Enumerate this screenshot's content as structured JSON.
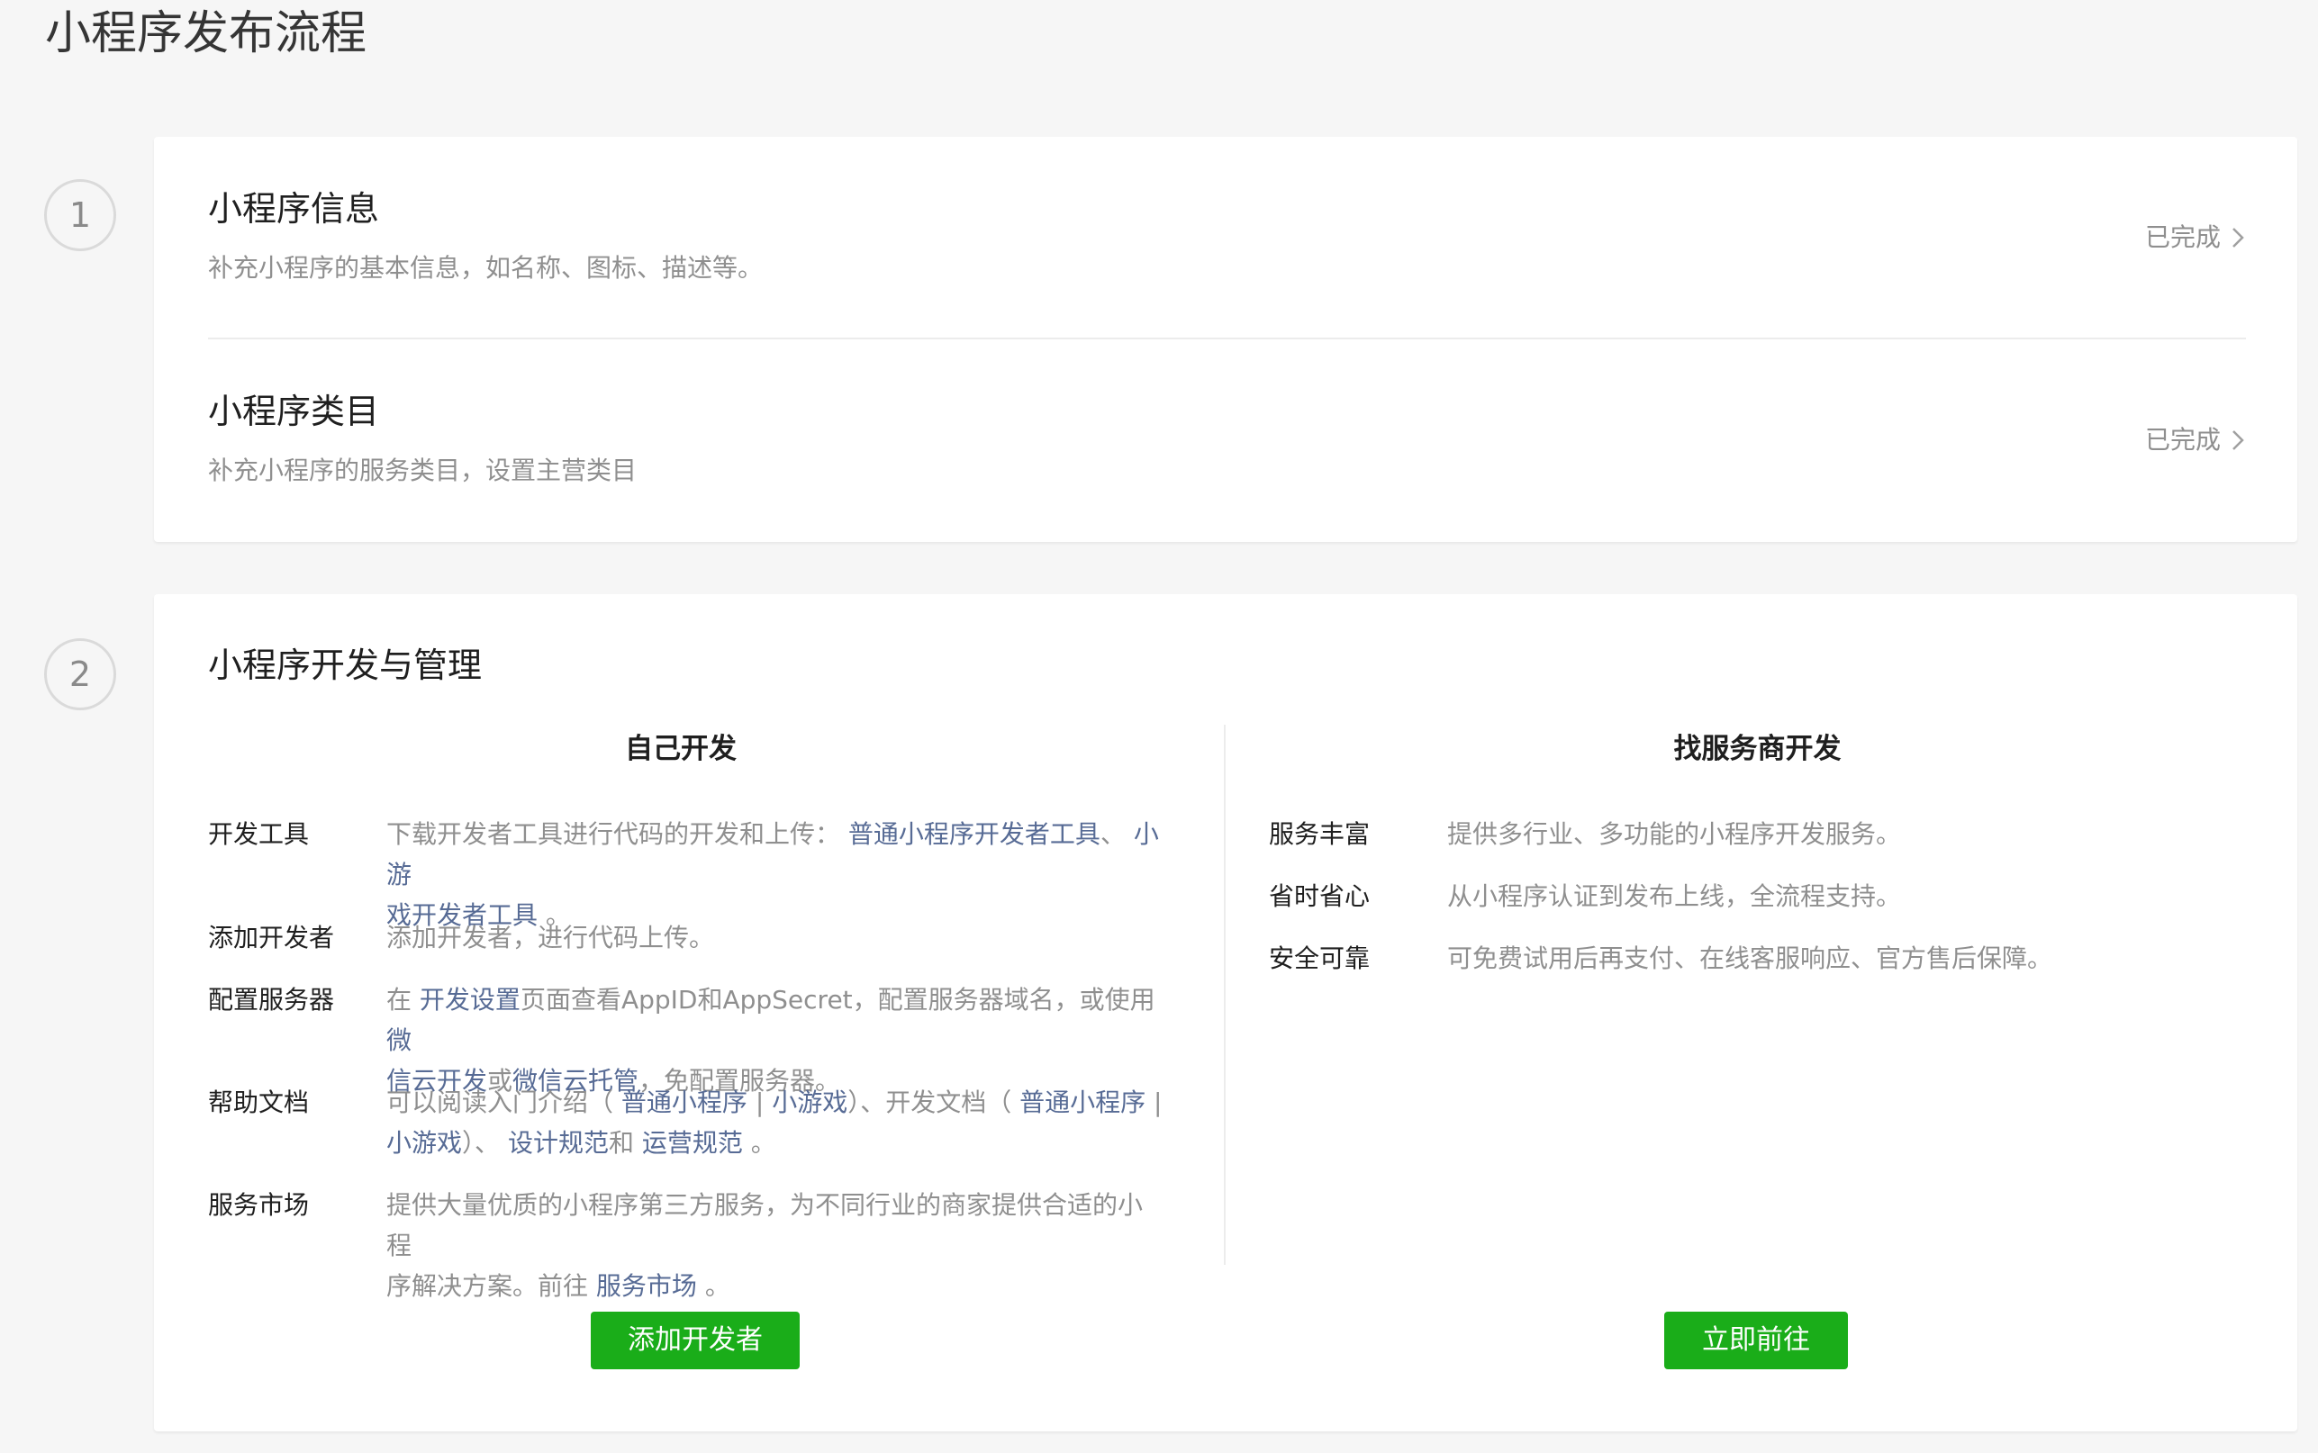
{
  "page_title": "小程序发布流程",
  "steps": [
    {
      "number": "1"
    },
    {
      "number": "2"
    }
  ],
  "section1": {
    "rows": [
      {
        "title": "小程序信息",
        "desc": "补充小程序的基本信息，如名称、图标、描述等。",
        "status": "已完成"
      },
      {
        "title": "小程序类目",
        "desc": "补充小程序的服务类目，设置主营类目",
        "status": "已完成"
      }
    ]
  },
  "section2": {
    "title": "小程序开发与管理",
    "self_dev": {
      "title": "自己开发",
      "items": {
        "tools": {
          "label": "开发工具",
          "t1": "下载开发者工具进行代码的开发和上传：",
          "link1": "普通小程序开发者工具",
          "t2": "、",
          "link2a": "小游",
          "link2b": "戏开发者工具",
          "t3": "。"
        },
        "add_dev": {
          "label": "添加开发者",
          "t1": "添加开发者，进行代码上传。"
        },
        "server": {
          "label": "配置服务器",
          "t1": "在",
          "link1": "开发设置",
          "t2": "页面查看AppID和AppSecret，配置服务器域名，或使用",
          "link2a": "微",
          "link2b": "信云开发",
          "t3": "或",
          "link3": "微信云托管",
          "t4": "，免配置服务器。"
        },
        "docs": {
          "label": "帮助文档",
          "t1": "可以阅读入门介绍（",
          "link1": "普通小程序",
          "sep1": "|",
          "link2": "小游戏",
          "t2": "）、开发文档（",
          "link3": "普通小程序",
          "sep2": "|",
          "link4": "小游戏",
          "t3": "）、",
          "link5": "设计规范",
          "t4": "和",
          "link6": "运营规范",
          "t5": "。"
        },
        "market": {
          "label": "服务市场",
          "t1a": "提供大量优质的小程序第三方服务，为不同行业的商家提供合适的小程",
          "t1b": "序解决方案。前往",
          "link1": "服务市场",
          "t2": "。"
        }
      },
      "button": "添加开发者"
    },
    "provider_dev": {
      "title": "找服务商开发",
      "items": [
        {
          "label": "服务丰富",
          "text": "提供多行业、多功能的小程序开发服务。"
        },
        {
          "label": "省时省心",
          "text": "从小程序认证到发布上线，全流程支持。"
        },
        {
          "label": "安全可靠",
          "text": "可免费试用后再支付、在线客服响应、官方售后保障。"
        }
      ],
      "button": "立即前往"
    }
  },
  "colors": {
    "accent_green": "#1aad19",
    "link_blue": "#576b95",
    "muted_text": "#8f8f8f",
    "background": "#f6f6f6"
  }
}
